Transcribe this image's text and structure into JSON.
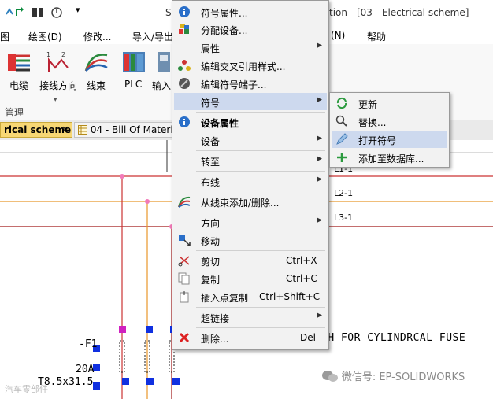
{
  "window": {
    "title_prefix": "S",
    "title_suffix": "tion - [03 - Electrical scheme]"
  },
  "menubar": {
    "items": [
      "图",
      "绘图(D)",
      "修改...",
      "导入/导出",
      "(N)",
      "帮助"
    ]
  },
  "ribbon": {
    "buttons": [
      "电缆",
      "接线方向",
      "线束",
      "PLC",
      "输入"
    ],
    "group_label": "管理"
  },
  "tabs": [
    {
      "label": "rical scheme",
      "close": "✕",
      "active": true
    },
    {
      "label": "04 - Bill Of Materi",
      "active": false
    }
  ],
  "canvas": {
    "wire_labels": [
      "L1-1",
      "L2-1",
      "L3-1"
    ],
    "note_text": "TH FOR CYLINDRCAL FUSE",
    "fuse_label": "-F1",
    "rating_label": "20A",
    "size_label": "T8.5x31.5"
  },
  "context_menu": {
    "items": [
      {
        "label": "符号属性...",
        "icon": "info-icon"
      },
      {
        "label": "分配设备...",
        "icon": "assign-device-icon"
      },
      {
        "label": "属性",
        "submenu": true
      },
      {
        "label": "编辑交叉引用样式...",
        "icon": "cross-reference-icon"
      },
      {
        "label": "编辑符号端子...",
        "icon": "edit-terminal-icon"
      },
      {
        "label": "符号",
        "submenu": true,
        "highlighted": true
      },
      {
        "label": "设备属性",
        "icon": "info-icon",
        "bold": true
      },
      {
        "label": "设备",
        "submenu": true
      },
      {
        "label": "转至",
        "submenu": true
      },
      {
        "label": "布线",
        "submenu": true
      },
      {
        "label": "从线束添加/删除...",
        "icon": "harness-icon"
      },
      {
        "label": "方向",
        "submenu": true
      },
      {
        "label": "移动",
        "icon": "move-icon"
      },
      {
        "label": "剪切",
        "shortcut": "Ctrl+X",
        "icon": "scissors-icon"
      },
      {
        "label": "复制",
        "shortcut": "Ctrl+C",
        "icon": "copy-icon"
      },
      {
        "label": "插入点复制",
        "shortcut": "Ctrl+Shift+C",
        "icon": "copy-insert-icon"
      },
      {
        "label": "超链接",
        "submenu": true
      },
      {
        "label": "删除...",
        "shortcut": "Del",
        "icon": "delete-icon"
      }
    ]
  },
  "submenu": {
    "items": [
      {
        "label": "更新",
        "icon": "refresh-icon"
      },
      {
        "label": "替换...",
        "icon": "search-icon"
      },
      {
        "label": "打开符号",
        "icon": "pencil-icon",
        "highlighted": true
      },
      {
        "label": "添加至数据库...",
        "icon": "plus-icon"
      }
    ]
  },
  "watermark": {
    "left": "汽车零部件",
    "right": "微信号: EP-SOLIDWORKS"
  }
}
